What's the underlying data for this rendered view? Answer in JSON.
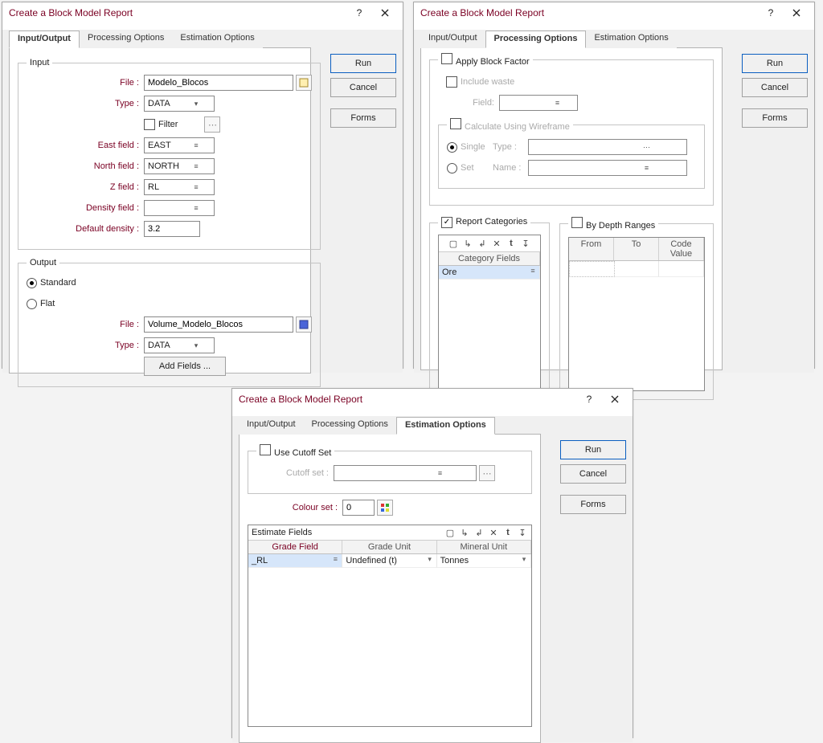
{
  "dialogs": {
    "d1": {
      "title": "Create a Block Model Report",
      "tabs": [
        "Input/Output",
        "Processing Options",
        "Estimation Options"
      ],
      "activeTab": 0,
      "input": {
        "legend": "Input",
        "file_label": "File :",
        "file_value": "Modelo_Blocos",
        "type_label": "Type :",
        "type_value": "DATA",
        "filter_label": "Filter",
        "east_label": "East field :",
        "east_value": "EAST",
        "north_label": "North field :",
        "north_value": "NORTH",
        "z_label": "Z field :",
        "z_value": "RL",
        "density_label": "Density field :",
        "density_value": "",
        "defdens_label": "Default density :",
        "defdens_value": "3.2"
      },
      "output": {
        "legend": "Output",
        "radio_standard": "Standard",
        "radio_flat": "Flat",
        "file_label": "File :",
        "file_value": "Volume_Modelo_Blocos",
        "type_label": "Type :",
        "type_value": "DATA",
        "addfields_btn": "Add Fields ..."
      }
    },
    "d2": {
      "title": "Create a Block Model Report",
      "tabs": [
        "Input/Output",
        "Processing Options",
        "Estimation Options"
      ],
      "activeTab": 1,
      "applyBlock_label": "Apply Block Factor",
      "includeWaste_label": "Include waste",
      "field_label": "Field:",
      "field_value": "",
      "calcWire_label": "Calculate Using Wireframe",
      "radio_single": "Single",
      "radio_set": "Set",
      "type_label": "Type :",
      "type_value": "",
      "name_label": "Name :",
      "name_value": "",
      "reportCat_label": "Report Categories",
      "catfields_label": "Category Fields",
      "cat_row": "Ore",
      "byDepth_label": "By Depth Ranges",
      "depth_cols": [
        "From",
        "To",
        "Code Value"
      ]
    },
    "d3": {
      "title": "Create a Block Model Report",
      "tabs": [
        "Input/Output",
        "Processing Options",
        "Estimation Options"
      ],
      "activeTab": 2,
      "useCutoff_label": "Use Cutoff Set",
      "cutoffset_label": "Cutoff set :",
      "cutoffset_value": "",
      "colourset_label": "Colour set :",
      "colourset_value": "0",
      "estFields_label": "Estimate Fields",
      "grid_cols": [
        "Grade Field",
        "Grade Unit",
        "Mineral Unit"
      ],
      "grid_row": {
        "grade": "_RL",
        "gunit": "Undefined (t)",
        "munit": "Tonnes"
      }
    },
    "buttons": {
      "run": "Run",
      "cancel": "Cancel",
      "forms": "Forms"
    }
  }
}
